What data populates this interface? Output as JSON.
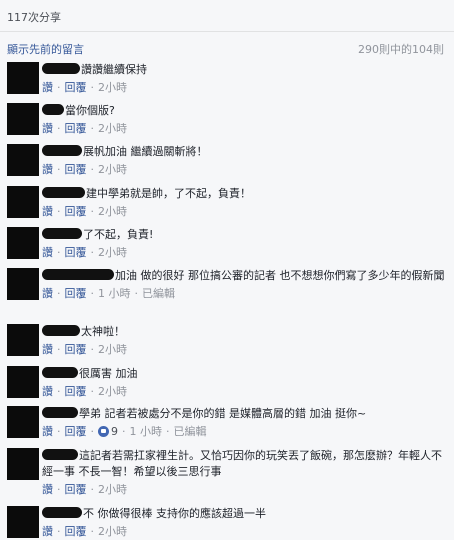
{
  "header": {
    "share_count": "117次分享"
  },
  "prev": {
    "label": "顯示先前的留言",
    "count": "290則中的104則"
  },
  "actions": {
    "like": "讚",
    "reply": "回覆"
  },
  "comments": [
    {
      "text": "讚讚繼續保持",
      "time": "2小時"
    },
    {
      "text": "當你個版?",
      "time": "2小時"
    },
    {
      "text": "展帆加油 繼續過關斬將！",
      "time": "2小時"
    },
    {
      "text": "建中學弟就是帥，了不起，負責！",
      "time": "2小時"
    },
    {
      "text": "了不起，負責!",
      "time": "2小時"
    },
    {
      "text": "加油 做的很好 那位搞公審的記者 也不想想你們寫了多少年的假新聞",
      "time": "1 小時",
      "edited": "已編輯"
    },
    {
      "text": "太神啦！",
      "time": "2小時"
    },
    {
      "text": "很厲害 加油",
      "time": "2小時"
    },
    {
      "text": "學弟 記者若被處分不是你的錯 是媒體高層的錯 加油 挺你~",
      "likes": "9",
      "time": "1 小時",
      "edited": "已編輯"
    },
    {
      "text": "這記者若需扛家裡生計。又恰巧因你的玩笑丟了飯碗，那怎麽辦？年輕人不經一事 不長一智！希望以後三思行事",
      "time": "2小時"
    },
    {
      "text": "不 你做得很棒 支持你的應該超過一半",
      "time": "2小時"
    }
  ]
}
